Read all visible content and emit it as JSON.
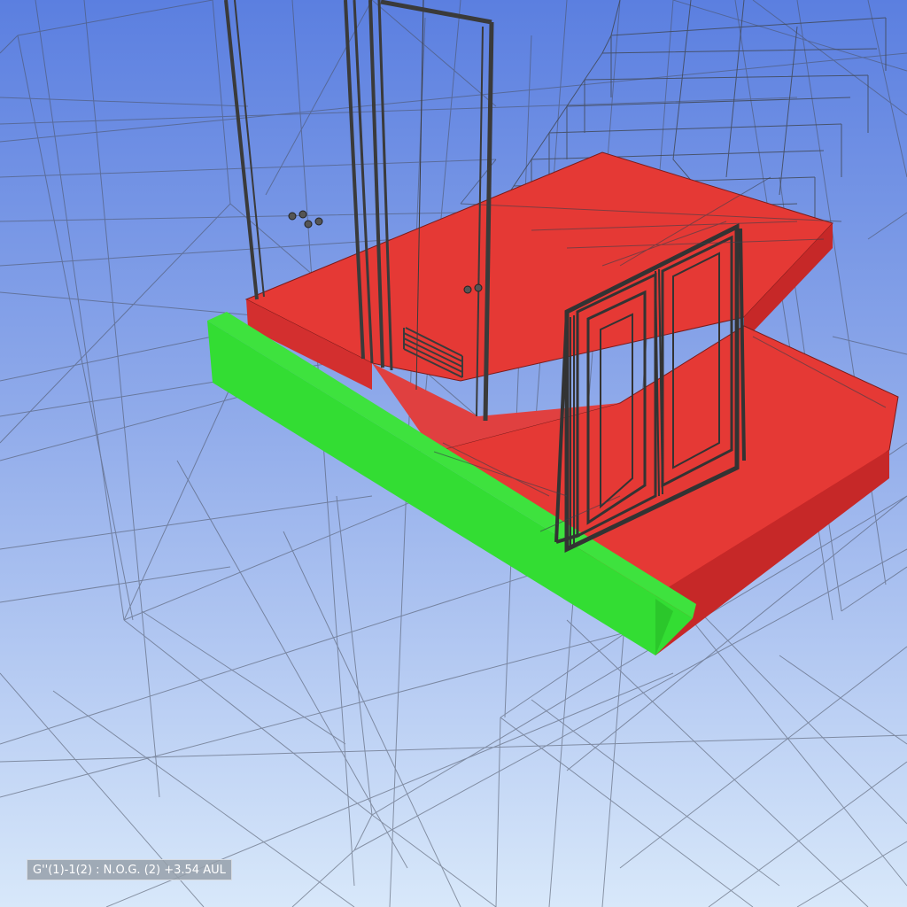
{
  "viewport": {
    "background_top": "#5b7fe0",
    "background_bottom": "#d8e8fa",
    "wire_color": "#4a5060"
  },
  "model": {
    "slab_color": "#e53935",
    "selected_element_color": "#33dd33",
    "door_frame_color": "#3a3a3a"
  },
  "status": {
    "level_label": "G''(1)-1(2) : N.O.G. (2) +3.54 AUL"
  }
}
